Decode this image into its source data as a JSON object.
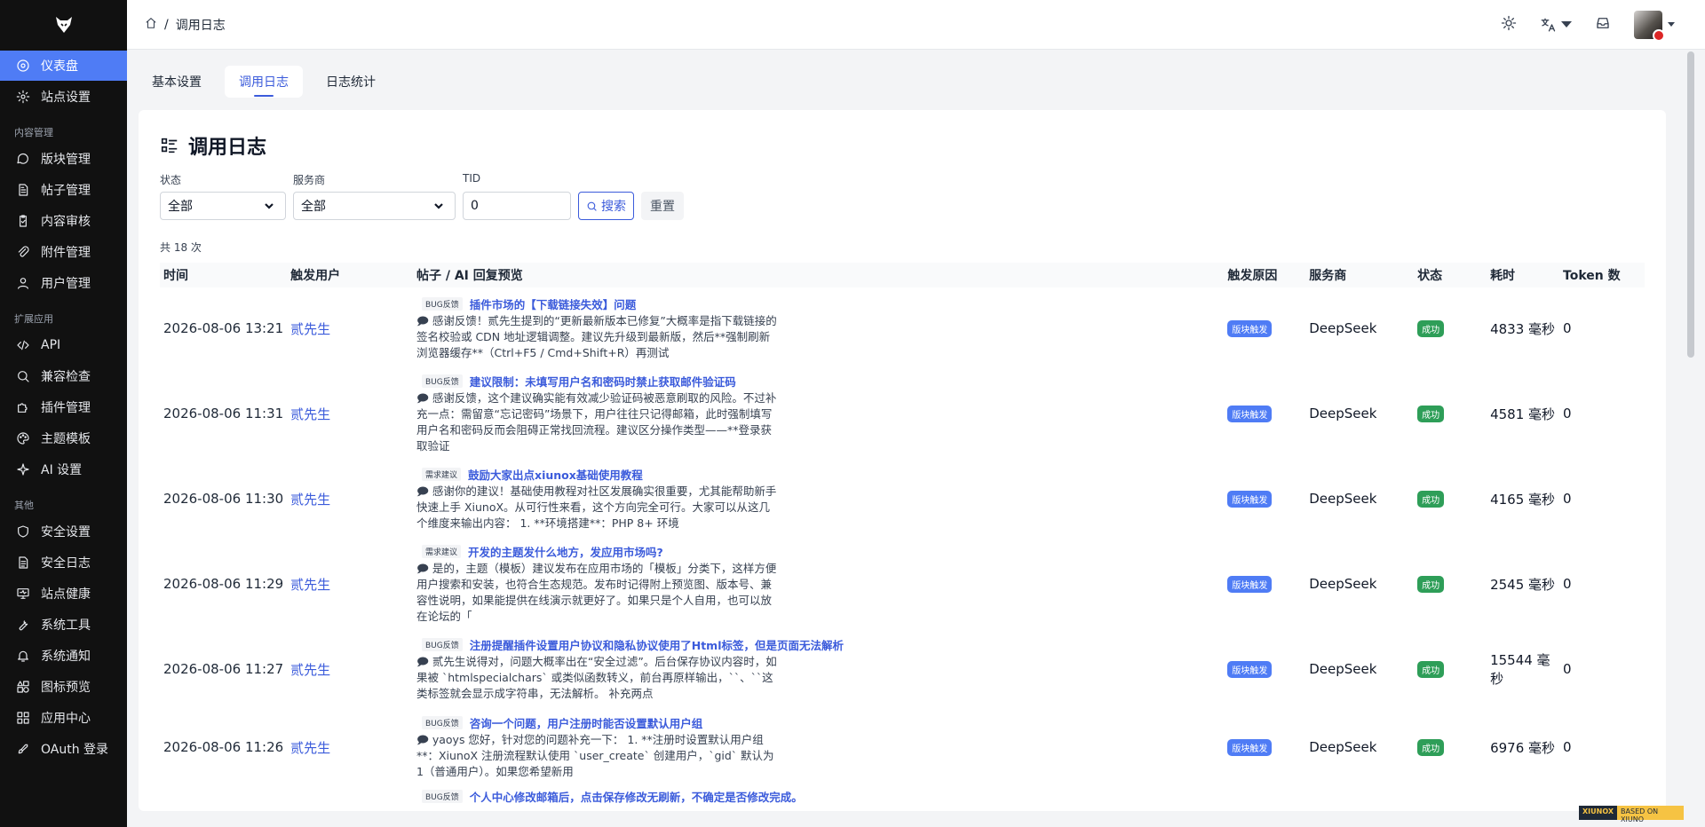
{
  "breadcrumb": {
    "current": "调用日志"
  },
  "sidebar": {
    "items": [
      {
        "label": "仪表盘",
        "icon": "dashboard-icon",
        "active": true
      },
      {
        "label": "站点设置",
        "icon": "gear-icon"
      },
      {
        "section": "内容管理"
      },
      {
        "label": "版块管理",
        "icon": "chat-icon"
      },
      {
        "label": "帖子管理",
        "icon": "document-icon"
      },
      {
        "label": "内容审核",
        "icon": "clipboard-check-icon"
      },
      {
        "label": "附件管理",
        "icon": "paperclip-icon"
      },
      {
        "label": "用户管理",
        "icon": "user-icon"
      },
      {
        "section": "扩展应用"
      },
      {
        "label": "API",
        "icon": "code-icon"
      },
      {
        "label": "兼容检查",
        "icon": "search-icon"
      },
      {
        "label": "插件管理",
        "icon": "puzzle-icon"
      },
      {
        "label": "主题模板",
        "icon": "palette-icon"
      },
      {
        "label": "AI 设置",
        "icon": "ai-icon"
      },
      {
        "section": "其他"
      },
      {
        "label": "安全设置",
        "icon": "shield-icon"
      },
      {
        "label": "安全日志",
        "icon": "log-icon"
      },
      {
        "label": "站点健康",
        "icon": "monitor-icon"
      },
      {
        "label": "系统工具",
        "icon": "wrench-icon"
      },
      {
        "label": "系统通知",
        "icon": "bell-icon"
      },
      {
        "label": "图标预览",
        "icon": "shapes-icon"
      },
      {
        "label": "应用中心",
        "icon": "grid-icon"
      },
      {
        "label": "OAuth 登录",
        "icon": "rocket-icon"
      }
    ]
  },
  "tabs": [
    {
      "label": "基本设置"
    },
    {
      "label": "调用日志",
      "active": true
    },
    {
      "label": "日志统计"
    }
  ],
  "page": {
    "title": "调用日志",
    "filters": {
      "status_label": "状态",
      "status_value": "全部",
      "provider_label": "服务商",
      "provider_value": "全部",
      "tid_label": "TID",
      "tid_value": "0",
      "search_button": "搜索",
      "reset_button": "重置"
    },
    "count_text": "共 18 次"
  },
  "table": {
    "headers": [
      "时间",
      "触发用户",
      "帖子 / AI 回复预览",
      "触发原因",
      "服务商",
      "状态",
      "耗时",
      "Token 数"
    ],
    "rows": [
      {
        "time": "2026-08-06 13:21",
        "user": "贰先生",
        "category": "BUG反馈",
        "post_title": "插件市场的【下载链接失效】问题",
        "preview": "感谢反馈！贰先生提到的“更新最新版本已修复”大概率是指下载链接的签名校验或 CDN 地址逻辑调整。建议先升级到最新版，然后**强制刷新浏览器缓存**（Ctrl+F5 / Cmd+Shift+R）再测试",
        "reason": "版块触发",
        "provider": "DeepSeek",
        "status": "成功",
        "duration": "4833 毫秒",
        "tokens": "0"
      },
      {
        "time": "2026-08-06 11:31",
        "user": "贰先生",
        "category": "BUG反馈",
        "post_title": "建议限制：未填写用户名和密码时禁止获取邮件验证码",
        "preview": "感谢反馈，这个建议确实能有效减少验证码被恶意刷取的风险。不过补充一点：需留意“忘记密码”场景下，用户往往只记得邮箱，此时强制填写用户名和密码反而会阻碍正常找回流程。建议区分操作类型——**登录获取验证",
        "reason": "版块触发",
        "provider": "DeepSeek",
        "status": "成功",
        "duration": "4581 毫秒",
        "tokens": "0"
      },
      {
        "time": "2026-08-06 11:30",
        "user": "贰先生",
        "category": "需求建议",
        "post_title": "鼓励大家出点xiunox基础使用教程",
        "preview": "感谢你的建议！基础使用教程对社区发展确实很重要，尤其能帮助新手快速上手 XiunoX。从可行性来看，这个方向完全可行。大家可以从这几个维度来输出内容： 1. **环境搭建**：PHP 8+ 环境",
        "reason": "版块触发",
        "provider": "DeepSeek",
        "status": "成功",
        "duration": "4165 毫秒",
        "tokens": "0"
      },
      {
        "time": "2026-08-06 11:29",
        "user": "贰先生",
        "category": "需求建议",
        "post_title": "开发的主题发什么地方，发应用市场吗?",
        "preview": "是的，主题（模板）建议发布在应用市场的「模板」分类下，这样方便用户搜索和安装，也符合生态规范。发布时记得附上预览图、版本号、兼容性说明，如果能提供在线演示就更好了。如果只是个人自用，也可以放在论坛的「",
        "reason": "版块触发",
        "provider": "DeepSeek",
        "status": "成功",
        "duration": "2545 毫秒",
        "tokens": "0"
      },
      {
        "time": "2026-08-06 11:27",
        "user": "贰先生",
        "category": "BUG反馈",
        "post_title": "注册提醒插件设置用户协议和隐私协议使用了Html标签，但是页面无法解析",
        "preview": "贰先生说得对，问题大概率出在“安全过滤”。后台保存协议内容时，如果被 `htmlspecialchars` 或类似函数转义，前台再原样输出，``、``这类标签就会显示成字符串，无法解析。 补充两点",
        "reason": "版块触发",
        "provider": "DeepSeek",
        "status": "成功",
        "duration": "15544 毫秒",
        "tokens": "0"
      },
      {
        "time": "2026-08-06 11:26",
        "user": "贰先生",
        "category": "BUG反馈",
        "post_title": "咨询一个问题，用户注册时能否设置默认用户组",
        "preview": "yaoys 您好，针对您的问题补充一下： 1. **注册时设置默认用户组**：XiunoX 注册流程默认使用 `user_create` 创建用户，`gid` 默认为 1（普通用户）。如果您希望新用",
        "reason": "版块触发",
        "provider": "DeepSeek",
        "status": "成功",
        "duration": "6976 毫秒",
        "tokens": "0"
      },
      {
        "time": "",
        "user": "",
        "category": "BUG反馈",
        "post_title": "个人中心修改邮箱后，点击保存修改无刷新，不确定是否修改完成。",
        "preview": "",
        "reason": "",
        "provider": "",
        "status": "",
        "duration": "",
        "tokens": ""
      }
    ]
  },
  "watermark": {
    "left": "XIUNOX",
    "right": "BASED ON XIUNO"
  }
}
